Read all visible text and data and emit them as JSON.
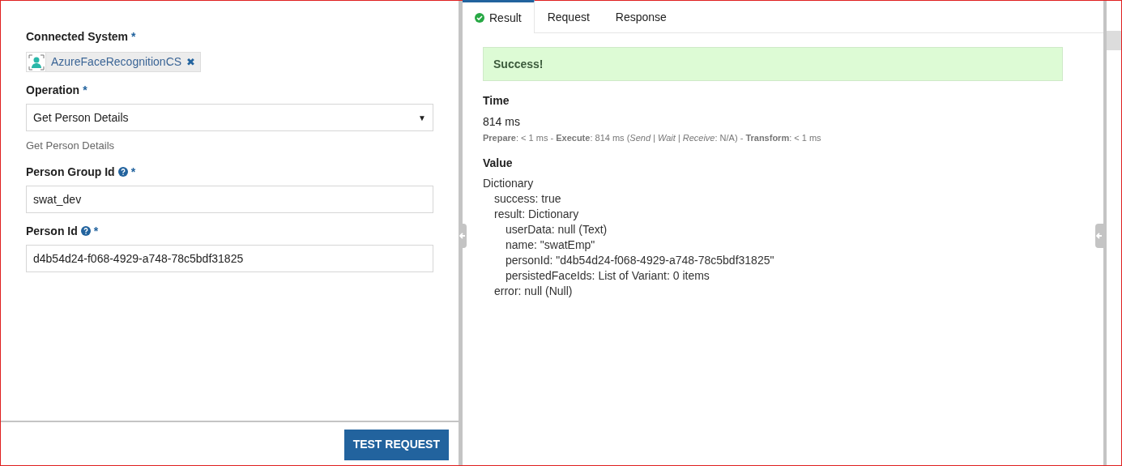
{
  "form": {
    "fields": [
      {
        "kind": "chip",
        "label": "Connected System",
        "required": "*",
        "help": false,
        "value": "AzureFaceRecognitionCS",
        "remove": "✖"
      },
      {
        "kind": "select",
        "label": "Operation",
        "required": "*",
        "help": false,
        "value": "Get Person Details",
        "caret": "▼",
        "hint": "Get Person Details"
      },
      {
        "kind": "text",
        "label": "Person Group Id",
        "required": "*",
        "help": true,
        "value": "swat_dev"
      },
      {
        "kind": "text",
        "label": "Person Id",
        "required": "*",
        "help": true,
        "value": "d4b54d24-f068-4929-a748-78c5bdf31825"
      }
    ],
    "button": "TEST REQUEST"
  },
  "tabs": [
    {
      "label": "Result",
      "selected": true,
      "success": true
    },
    {
      "label": "Request",
      "selected": false,
      "success": false
    },
    {
      "label": "Response",
      "selected": false,
      "success": false
    }
  ],
  "result": {
    "banner": "Success!",
    "time_heading": "Time",
    "time": "814 ms",
    "breakdown": "**Prepare**: < 1 ms - **Execute**: 814 ms (*Send | Wait | Receive*: N/A) - **Transform**: < 1 ms",
    "value_heading": "Value",
    "value": {
      "text": "Dictionary",
      "children": [
        {
          "text": "success: true"
        },
        {
          "text": "result: Dictionary",
          "children": [
            {
              "text": "userData: null (Text)"
            },
            {
              "text": "name: \"swatEmp\""
            },
            {
              "text": "personId: \"d4b54d24-f068-4929-a748-78c5bdf31825\""
            },
            {
              "text": "persistedFaceIds: List of Variant: 0 items"
            }
          ]
        },
        {
          "text": "error: null (Null)"
        }
      ]
    }
  }
}
